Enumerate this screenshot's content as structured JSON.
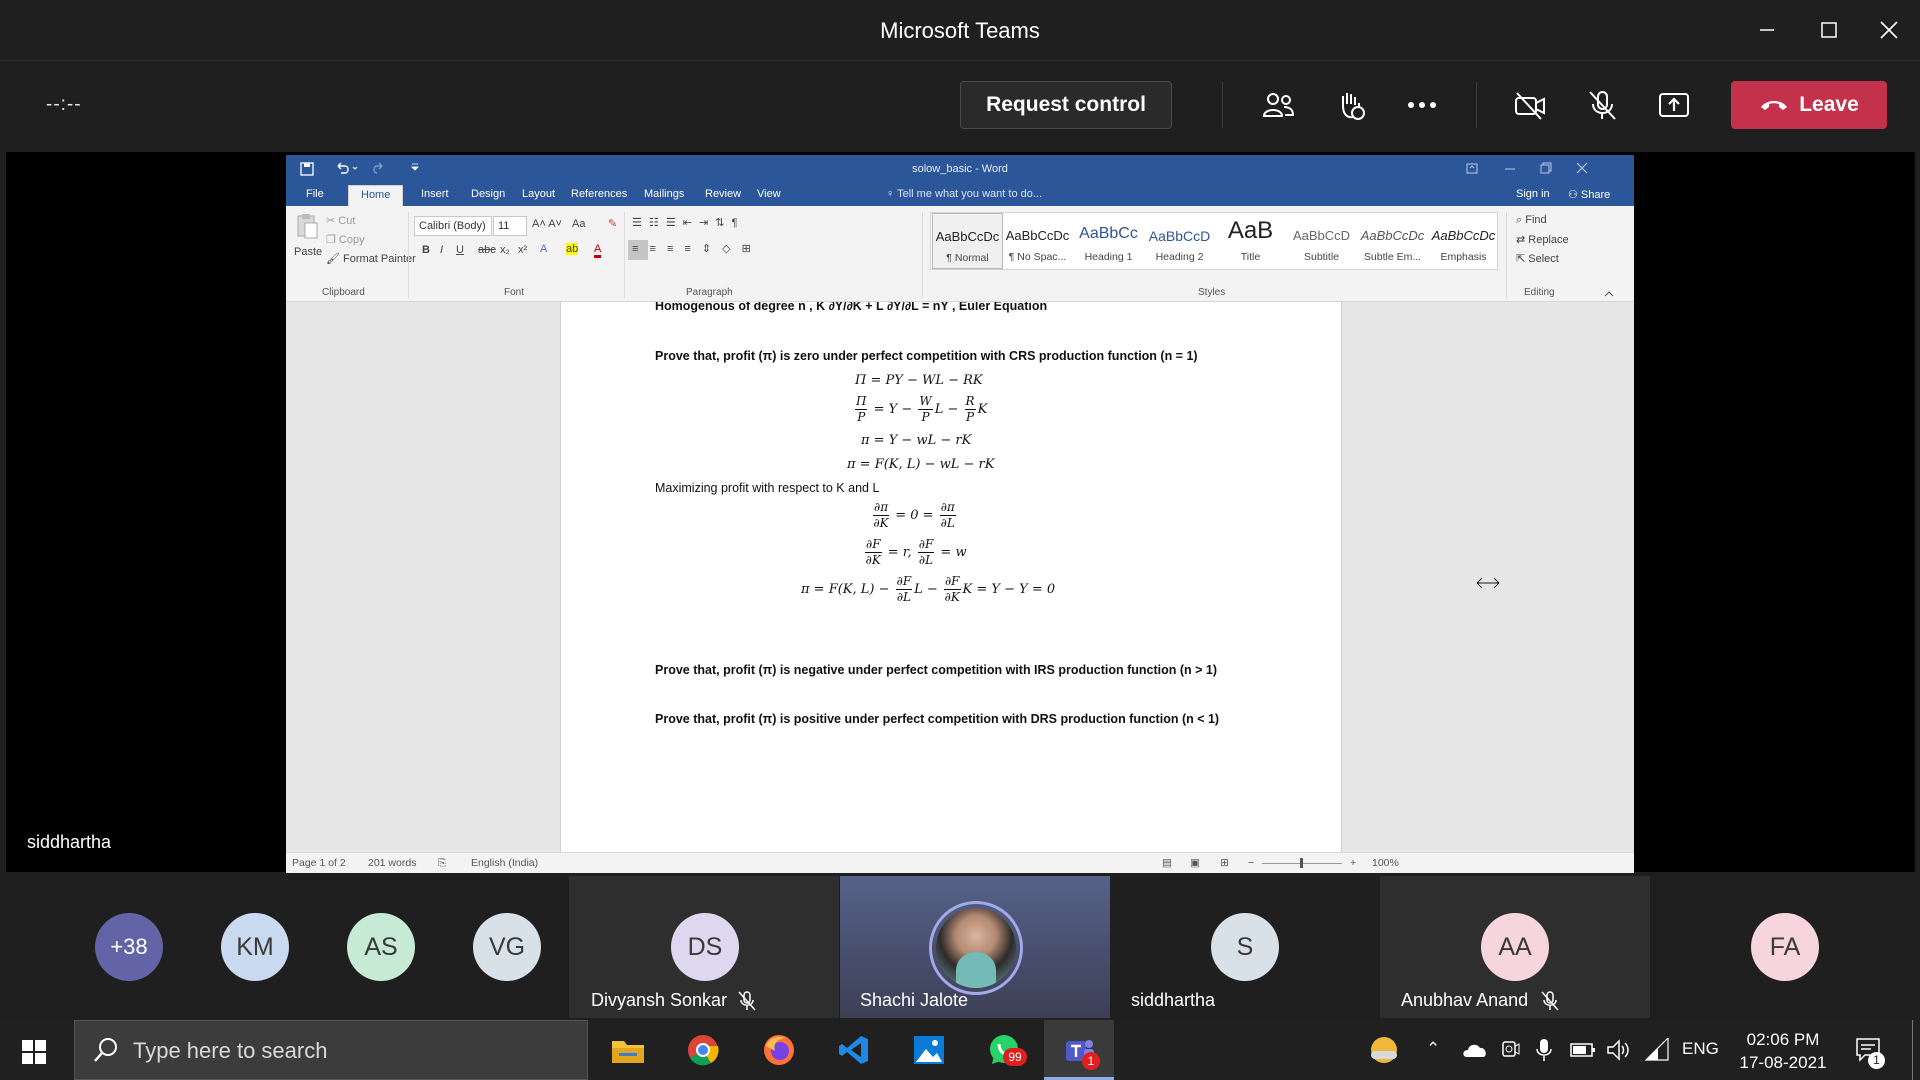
{
  "window": {
    "title": "Microsoft Teams"
  },
  "meeting": {
    "timer": "--:--",
    "request_control": "Request control",
    "leave": "Leave",
    "shared_by": "siddhartha"
  },
  "word": {
    "doc_title": "solow_basic - Word",
    "tabs": [
      "File",
      "Home",
      "Insert",
      "Design",
      "Layout",
      "References",
      "Mailings",
      "Review",
      "View"
    ],
    "tell_me": "Tell me what you want to do...",
    "sign_in": "Sign in",
    "share": "Share",
    "clipboard": {
      "paste": "Paste",
      "cut": "Cut",
      "copy": "Copy",
      "format_painter": "Format Painter",
      "label": "Clipboard"
    },
    "font": {
      "name": "Calibri (Body)",
      "size": "11",
      "label": "Font",
      "case": "Aa"
    },
    "paragraph_label": "Paragraph",
    "styles": [
      {
        "preview": "AaBbCcDc",
        "name": "¶ Normal"
      },
      {
        "preview": "AaBbCcDc",
        "name": "¶ No Spac..."
      },
      {
        "preview": "AaBbCc",
        "name": "Heading 1"
      },
      {
        "preview": "AaBbCcD",
        "name": "Heading 2"
      },
      {
        "preview": "AaB",
        "name": "Title"
      },
      {
        "preview": "AaBbCcD",
        "name": "Subtitle"
      },
      {
        "preview": "AaBbCcDc",
        "name": "Subtle Em..."
      },
      {
        "preview": "AaBbCcDc",
        "name": "Emphasis"
      }
    ],
    "styles_label": "Styles",
    "editing": {
      "find": "Find",
      "replace": "Replace",
      "select": "Select",
      "label": "Editing"
    },
    "doc": {
      "line_top": "Homogenous of degree n , K ∂Y/∂K + L ∂Y/∂L = nY , Euler Equation",
      "p1": "Prove that, profit (π) is zero under perfect competition with CRS production function (n = 1)",
      "eq1": "Π = PY − WL − RK",
      "eq3": "π = Y − wL − rK",
      "eq4": "π = F(K, L) − wL − rK",
      "p2": "Maximizing profit with respect to K and L",
      "p3": "Prove that, profit (π) is negative under perfect competition with IRS production function (n > 1)",
      "p4": "Prove that, profit (π) is positive under perfect competition with DRS production function (n < 1)"
    },
    "status": {
      "page": "Page 1 of 2",
      "words": "201 words",
      "language": "English (India)",
      "zoom": "100%"
    }
  },
  "participants": [
    {
      "initials": "+38",
      "color": "#6264a7"
    },
    {
      "initials": "KM",
      "color": "#c9d9ef"
    },
    {
      "initials": "AS",
      "color": "#c6ead4"
    },
    {
      "initials": "VG",
      "color": "#d9e1e8"
    },
    {
      "initials": "DS",
      "name": "Divyansh Sonkar",
      "color": "#ddd8ef"
    },
    {
      "name": "Shachi Jalote"
    },
    {
      "initials": "S",
      "name": "siddhartha",
      "color": "#d9e1e8"
    },
    {
      "initials": "AA",
      "name": "Anubhav Anand",
      "color": "#f6d5df"
    },
    {
      "initials": "FA",
      "color": "#f6d5df"
    }
  ],
  "taskbar": {
    "search_placeholder": "Type here to search",
    "whatsapp_badge": "99",
    "teams_badge": "1",
    "lang": "ENG",
    "time": "02:06 PM",
    "date": "17-08-2021",
    "notif_count": "1"
  }
}
